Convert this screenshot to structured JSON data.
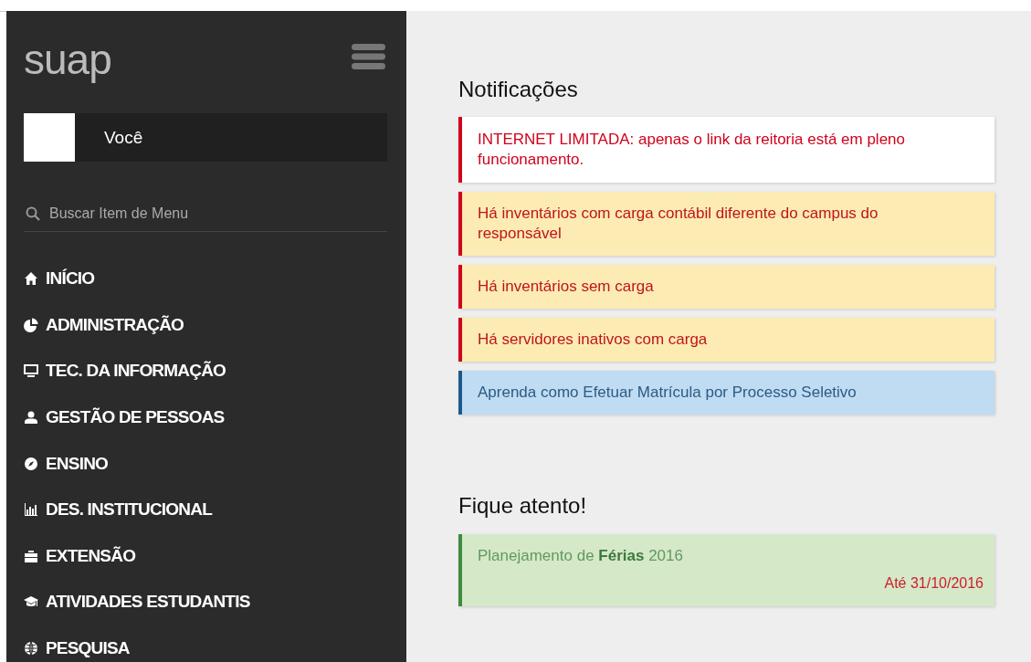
{
  "sidebar": {
    "logo": "suap",
    "user": {
      "name": "Você"
    },
    "search": {
      "placeholder": "Buscar Item de Menu"
    },
    "menu": [
      {
        "label": "INÍCIO"
      },
      {
        "label": "ADMINISTRAÇÃO"
      },
      {
        "label": "TEC. DA INFORMAÇÃO"
      },
      {
        "label": "GESTÃO DE PESSOAS"
      },
      {
        "label": "ENSINO"
      },
      {
        "label": "DES. INSTITUCIONAL"
      },
      {
        "label": "EXTENSÃO"
      },
      {
        "label": "ATIVIDADES ESTUDANTIS"
      },
      {
        "label": "PESQUISA"
      }
    ]
  },
  "notifications": {
    "title": "Notificações",
    "items": [
      {
        "kind": "alert",
        "text": "INTERNET LIMITADA: apenas o link da reitoria está em pleno funcionamento."
      },
      {
        "kind": "warning",
        "text": "Há inventários com carga contábil diferente do campus do responsável"
      },
      {
        "kind": "warning",
        "text": "Há inventários sem carga"
      },
      {
        "kind": "warning",
        "text": "Há servidores inativos com carga"
      },
      {
        "kind": "info",
        "text": "Aprenda como Efetuar Matrícula por Processo Seletivo"
      }
    ]
  },
  "attention": {
    "title": "Fique atento!",
    "items": [
      {
        "kind": "success",
        "text": "Planejamento de **Férias** 2016",
        "deadline": "Até 31/10/2016"
      }
    ]
  }
}
